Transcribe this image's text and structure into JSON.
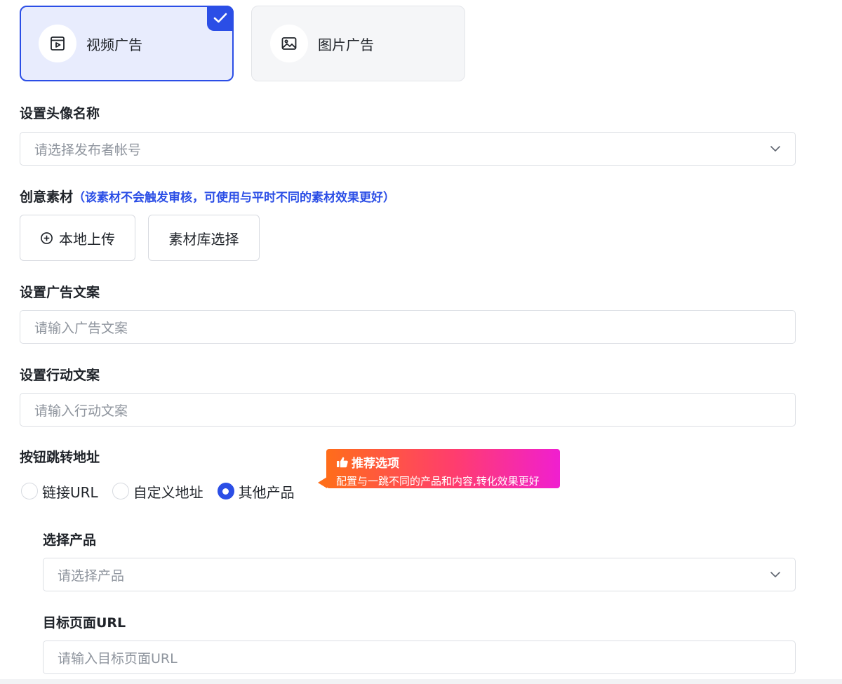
{
  "ad_types": {
    "video": {
      "label": "视频广告",
      "selected": true
    },
    "image": {
      "label": "图片广告",
      "selected": false
    }
  },
  "avatar_name": {
    "label": "设置头像名称",
    "placeholder": "请选择发布者帐号"
  },
  "creative": {
    "label": "创意素材",
    "hint": "（该素材不会触发审核，可使用与平时不同的素材效果更好）",
    "upload_label": "本地上传",
    "library_label": "素材库选择"
  },
  "ad_copy": {
    "label": "设置广告文案",
    "placeholder": "请输入广告文案"
  },
  "action_copy": {
    "label": "设置行动文案",
    "placeholder": "请输入行动文案"
  },
  "jump": {
    "label": "按钮跳转地址",
    "options": [
      {
        "label": "链接URL",
        "selected": false
      },
      {
        "label": "自定义地址",
        "selected": false
      },
      {
        "label": "其他产品",
        "selected": true
      }
    ],
    "badge_title": "推荐选项",
    "badge_sub": "配置与一跳不同的产品和内容,转化效果更好"
  },
  "product": {
    "label": "选择产品",
    "placeholder": "请选择产品"
  },
  "target_url": {
    "label": "目标页面URL",
    "placeholder": "请输入目标页面URL"
  },
  "colors": {
    "accent": "#2b4ee6",
    "selected_bg": "#e8ecfd",
    "badge_gradient_start": "#ff6d1a",
    "badge_gradient_end": "#f01fd0"
  },
  "icons": {
    "video": "video-file-icon",
    "image": "image-icon",
    "check": "checkmark-icon",
    "upload": "plus-circle-icon",
    "dropdown": "chevron-down-icon",
    "badge": "thumbs-up-icon"
  }
}
